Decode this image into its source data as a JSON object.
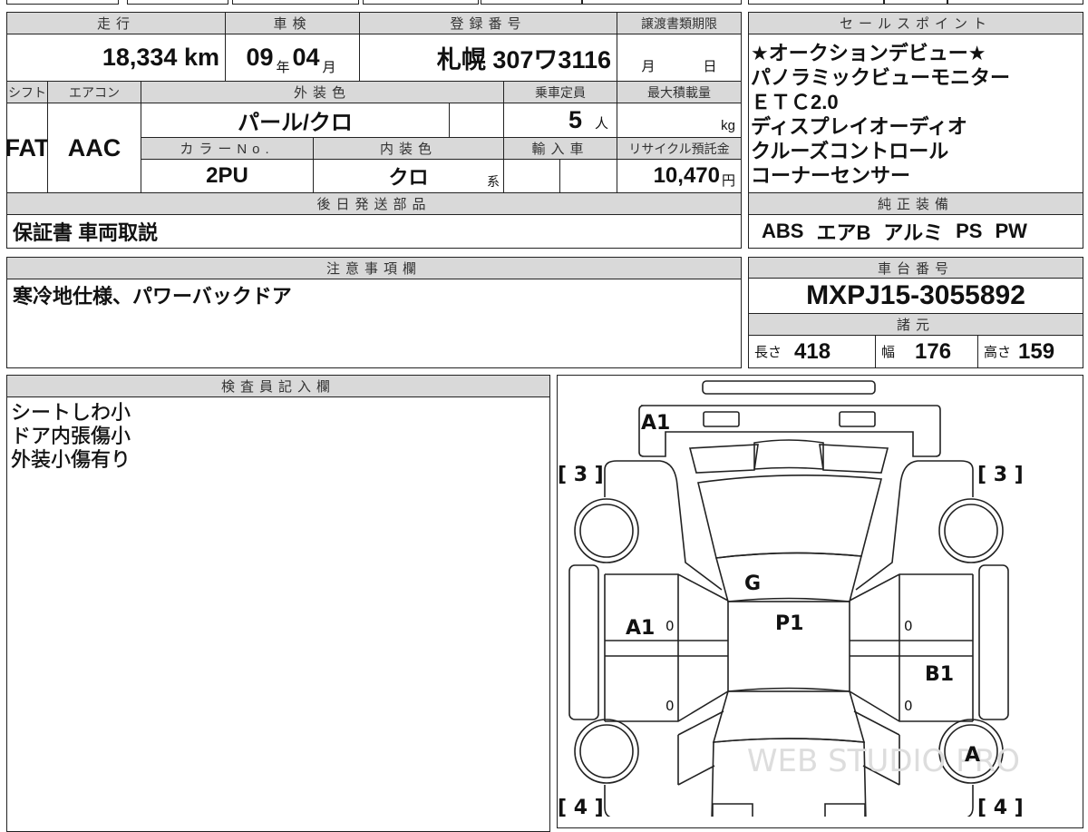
{
  "basic": {
    "mileage_label": "走行",
    "mileage_value": "18,334",
    "mileage_unit": "km",
    "inspection_label": "車検",
    "inspection_year": "09",
    "year_unit": "年",
    "inspection_month": "04",
    "month_unit": "月",
    "registration_label": "登録番号",
    "registration_value": "札幌 307ワ3116",
    "transfer_deadline_label": "譲渡書類期限",
    "transfer_month_unit": "月",
    "transfer_day_unit": "日",
    "shift_label": "シフト",
    "shift_value": "FAT",
    "aircon_label": "エアコン",
    "aircon_value": "AAC",
    "exterior_color_label": "外装色",
    "exterior_color_value": "パール/クロ",
    "capacity_label": "乗車定員",
    "capacity_value": "5",
    "capacity_unit": "人",
    "max_load_label": "最大積載量",
    "max_load_unit": "kg",
    "color_no_label": "カラーNo.",
    "color_no_value": "2PU",
    "interior_color_label": "内装色",
    "interior_color_value": "クロ",
    "interior_color_suffix": "系",
    "import_label": "輸入車",
    "recycle_label": "リサイクル預託金",
    "recycle_value": "10,470",
    "recycle_unit": "円",
    "later_parts_label": "後日発送部品",
    "later_parts_value": "保証書 車両取説"
  },
  "sales_points": {
    "label": "セールスポイント",
    "items": [
      "★オークションデビュー★",
      "パノラミックビューモニター",
      "ＥＴＣ2.0",
      "ディスプレイオーディオ",
      "クルーズコントロール",
      "コーナーセンサー"
    ]
  },
  "equipment": {
    "label": "純正装備",
    "items": [
      "ABS",
      "エアB",
      "アルミ",
      "PS",
      "PW"
    ]
  },
  "notes": {
    "label": "注意事項欄",
    "value": "寒冷地仕様、パワーバックドア"
  },
  "chassis": {
    "label": "車台番号",
    "value": "MXPJ15-3055892"
  },
  "specs": {
    "label": "諸元",
    "length_label": "長さ",
    "length_value": "418",
    "width_label": "幅",
    "width_value": "176",
    "height_label": "高さ",
    "height_value": "159"
  },
  "inspector": {
    "label": "検査員記入欄",
    "lines": [
      "シートしわ小",
      "ドア内張傷小",
      "外装小傷有り"
    ]
  },
  "diagram": {
    "hood_mark": "A1",
    "roof_front_mark": "G",
    "roof_mark": "P1",
    "left_door_mark": "A1",
    "right_rear_door_mark": "B1",
    "right_rear_wheel_mark": "A",
    "zero_marks": [
      "0",
      "0",
      "0",
      "0"
    ],
    "front_left_bracket": "[ 3 ]",
    "front_right_bracket": "[ 3 ]",
    "rear_left_bracket": "[ 4 ]",
    "rear_right_bracket": "[ 4 ]",
    "watermark": "WEB STUDIO PRO"
  }
}
